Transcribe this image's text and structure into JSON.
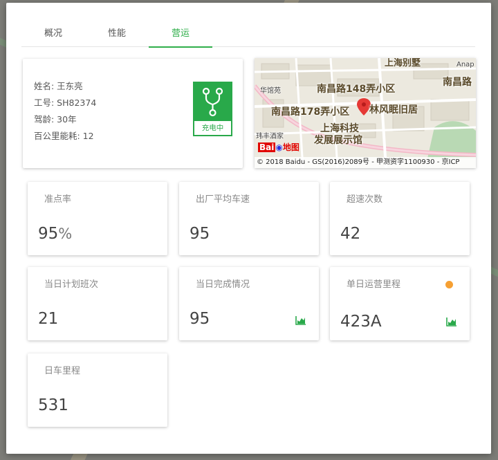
{
  "tabs": [
    {
      "label": "概况",
      "active": false
    },
    {
      "label": "性能",
      "active": false
    },
    {
      "label": "营运",
      "active": true
    }
  ],
  "driver": {
    "name_line": "姓名: 王东亮",
    "id_line": "工号: SH82374",
    "years_line": "驾龄: 30年",
    "energy_line": "百公里能耗: 12",
    "status_label": "充电中",
    "status_icon": "branch-icon"
  },
  "map": {
    "labels": [
      "上海别墅",
      "南昌路148弄小区",
      "南昌路",
      "南昌路178弄小区",
      "林风眠旧居",
      "上海科技",
      "发展展示馆",
      "华馆苑",
      "玮丰酒家",
      "Anap"
    ],
    "brand": "Baidu地图",
    "copyright": "© 2018 Baidu - GS(2016)2089号 - 甲测资字1100930 - 京ICP"
  },
  "stats": [
    {
      "title": "准点率",
      "value": "95",
      "unit": "%",
      "has_chart": false,
      "has_dot": false
    },
    {
      "title": "出厂平均车速",
      "value": "95",
      "unit": "",
      "has_chart": false,
      "has_dot": false
    },
    {
      "title": "超速次数",
      "value": "42",
      "unit": "",
      "has_chart": false,
      "has_dot": false
    },
    {
      "title": "当日计划班次",
      "value": "21",
      "unit": "",
      "has_chart": false,
      "has_dot": false
    },
    {
      "title": "当日完成情况",
      "value": "95",
      "unit": "",
      "has_chart": true,
      "has_dot": false
    },
    {
      "title": "单日运营里程",
      "value": "423A",
      "unit": "",
      "has_chart": true,
      "has_dot": true
    },
    {
      "title": "日车里程",
      "value": "531",
      "unit": "",
      "has_chart": false,
      "has_dot": false
    }
  ],
  "colors": {
    "accent": "#2fae4a",
    "dot": "#f6a033",
    "pin": "#e53935"
  }
}
